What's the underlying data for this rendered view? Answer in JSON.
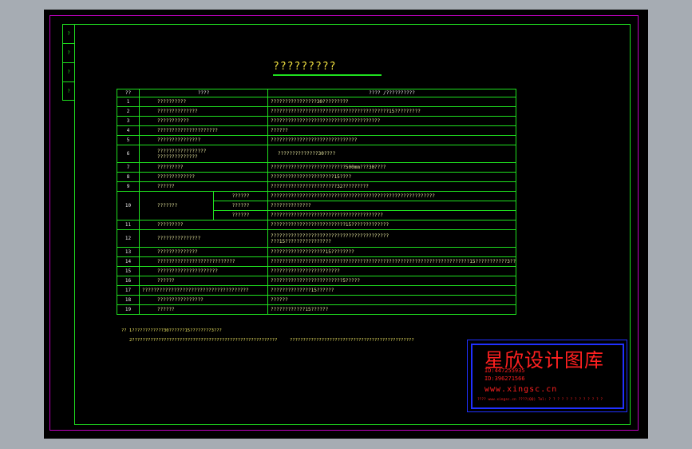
{
  "drawing": {
    "title": "?????????",
    "side_marks": [
      "?",
      "?",
      "?",
      "?"
    ]
  },
  "table": {
    "header": {
      "num": "??",
      "item": "????",
      "req": "???? /??????????"
    },
    "rows": [
      {
        "num": "1",
        "item": "??????????",
        "req": "????????????????30?????????"
      },
      {
        "num": "2",
        "item": "??????????????",
        "req": "?????????????????????????????????????????15?????????"
      },
      {
        "num": "3",
        "item": "???????????",
        "req": "??????????????????????????????????????"
      },
      {
        "num": "4",
        "item": "?????????????????????",
        "req": "??????"
      },
      {
        "num": "5",
        "item": "???????????????",
        "req": "??????????????????????????????"
      },
      {
        "num": "6",
        "item": "?????????????????\n??????????????",
        "req": "??????????????30????"
      },
      {
        "num": "7",
        "item": "?????????",
        "req": "??????????????????????????500mm???30????"
      },
      {
        "num": "8",
        "item": "?????????????",
        "req": "??????????????????????15????"
      },
      {
        "num": "9",
        "item": "??????",
        "req": "???????????????????????32?????????"
      },
      {
        "num": "10",
        "item": "???????",
        "sub": [
          {
            "label": "??????",
            "req": "?????????????????????????????????????????????????????????"
          },
          {
            "label": "??????",
            "req": "??????????????"
          },
          {
            "label": "??????",
            "req": "???????????????????????????????????????"
          }
        ]
      },
      {
        "num": "11",
        "item": "?????????",
        "req": "??????????????????????????15?????????????"
      },
      {
        "num": "12",
        "item": "???????????????",
        "req": "?????????????????????????????????????????\n???15????????????????"
      },
      {
        "num": "13",
        "item": "??????????????",
        "req": "???????????????????15????????"
      },
      {
        "num": "14",
        "item": "???????????????????????????",
        "req": "?????????????????????????????????????????????????????????????????????15???????????3????"
      },
      {
        "num": "15",
        "item": "?????????????????????",
        "req": "????????????????????????"
      },
      {
        "num": "16",
        "item": "??????",
        "req": "?????????????????????????5?????"
      },
      {
        "num": "17",
        "item": "?????????????????????????????????????",
        "req": "??????????????15??????"
      },
      {
        "num": "18",
        "item": "????????????????",
        "req": "??????"
      },
      {
        "num": "19",
        "item": "??????",
        "req": "????????????15??????"
      }
    ]
  },
  "notes": {
    "line1": "??   1????????????30??????15????????3???",
    "line2a": "2???????????????????????????????????????????????????????",
    "line2b": "???????????????????????????????????????????????"
  },
  "stamp": {
    "title": "星欣设计图库",
    "qq1": "ID:447255935",
    "qq2": "ID:396271566",
    "website": "www.xingsc.cn",
    "footer": "????   www.xingsc.cn    ????(QQ)    Tel:  ? ? ? ? ? ? ? ? ? ? ? ? ?"
  },
  "colors": {
    "frame": "#1fe01f",
    "border": "#c000c0",
    "stamp": "#2030ff",
    "stamp_text": "#ff2020"
  }
}
